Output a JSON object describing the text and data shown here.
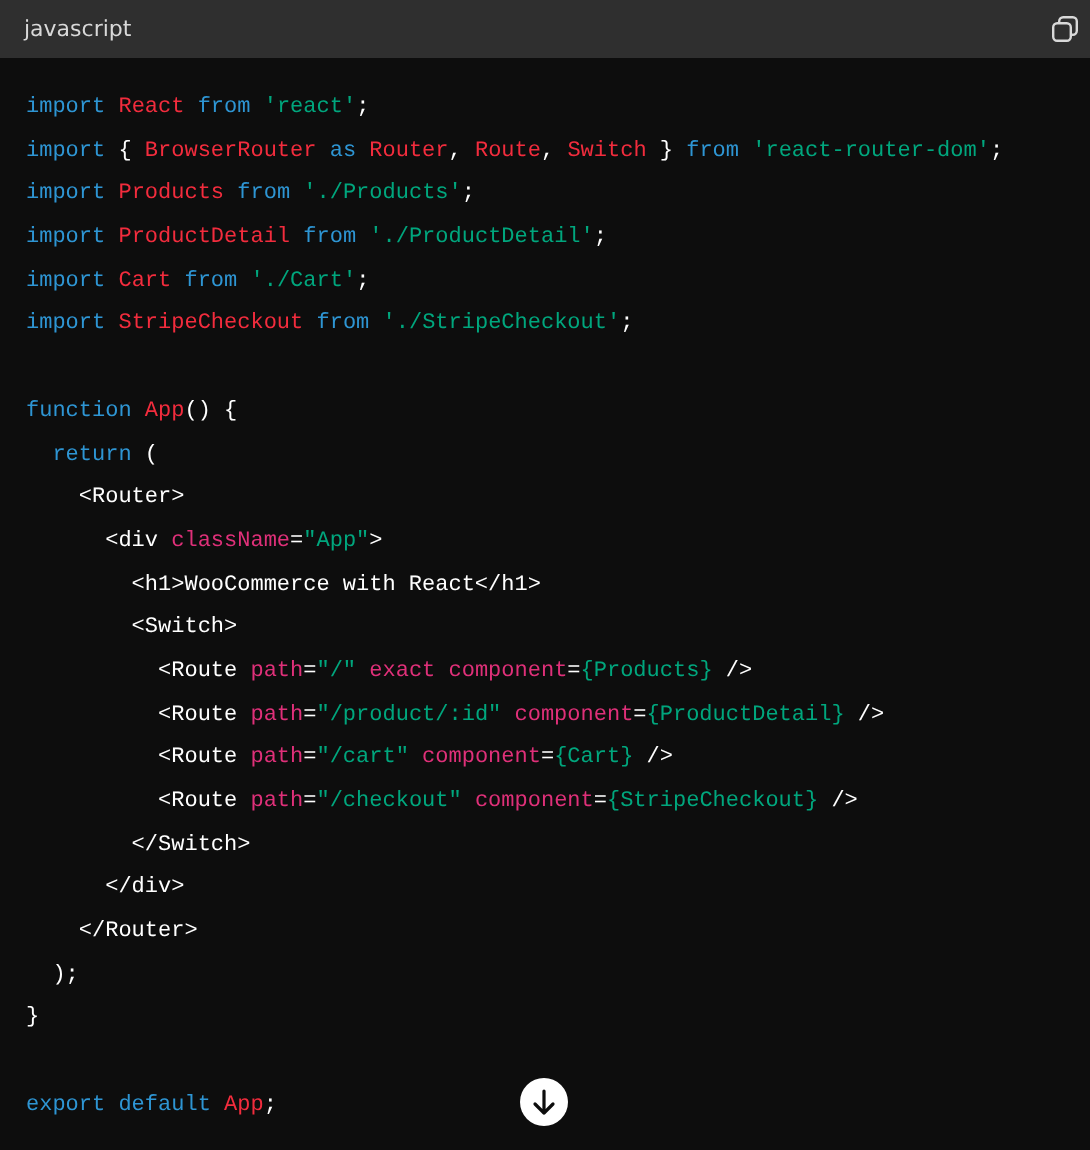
{
  "header": {
    "language": "javascript"
  },
  "lines": [
    {
      "kind": "code",
      "tokens": [
        {
          "kind": "kw",
          "text": "import "
        },
        {
          "kind": "name",
          "text": "React "
        },
        {
          "kind": "kw",
          "text": "from "
        },
        {
          "kind": "str",
          "text": "'react'"
        },
        {
          "kind": "plain",
          "text": ";"
        }
      ]
    },
    {
      "kind": "code",
      "tokens": [
        {
          "kind": "kw",
          "text": "import "
        },
        {
          "kind": "plain",
          "text": "{ "
        },
        {
          "kind": "name",
          "text": "BrowserRouter "
        },
        {
          "kind": "kw",
          "text": "as "
        },
        {
          "kind": "name",
          "text": "Router"
        },
        {
          "kind": "plain",
          "text": ", "
        },
        {
          "kind": "name",
          "text": "Route"
        },
        {
          "kind": "plain",
          "text": ", "
        },
        {
          "kind": "name",
          "text": "Switch"
        },
        {
          "kind": "plain",
          "text": " } "
        },
        {
          "kind": "kw",
          "text": "from "
        },
        {
          "kind": "str",
          "text": "'react-router-dom'"
        },
        {
          "kind": "plain",
          "text": ";"
        }
      ]
    },
    {
      "kind": "code",
      "tokens": [
        {
          "kind": "kw",
          "text": "import "
        },
        {
          "kind": "name",
          "text": "Products "
        },
        {
          "kind": "kw",
          "text": "from "
        },
        {
          "kind": "str",
          "text": "'./Products'"
        },
        {
          "kind": "plain",
          "text": ";"
        }
      ]
    },
    {
      "kind": "code",
      "tokens": [
        {
          "kind": "kw",
          "text": "import "
        },
        {
          "kind": "name",
          "text": "ProductDetail "
        },
        {
          "kind": "kw",
          "text": "from "
        },
        {
          "kind": "str",
          "text": "'./ProductDetail'"
        },
        {
          "kind": "plain",
          "text": ";"
        }
      ]
    },
    {
      "kind": "code",
      "tokens": [
        {
          "kind": "kw",
          "text": "import "
        },
        {
          "kind": "name",
          "text": "Cart "
        },
        {
          "kind": "kw",
          "text": "from "
        },
        {
          "kind": "str",
          "text": "'./Cart'"
        },
        {
          "kind": "plain",
          "text": ";"
        }
      ]
    },
    {
      "kind": "code",
      "tokens": [
        {
          "kind": "kw",
          "text": "import "
        },
        {
          "kind": "name",
          "text": "StripeCheckout "
        },
        {
          "kind": "kw",
          "text": "from "
        },
        {
          "kind": "str",
          "text": "'./StripeCheckout'"
        },
        {
          "kind": "plain",
          "text": ";"
        }
      ]
    },
    {
      "kind": "blank"
    },
    {
      "kind": "code",
      "tokens": [
        {
          "kind": "kw",
          "text": "function "
        },
        {
          "kind": "name",
          "text": "App"
        },
        {
          "kind": "plain",
          "text": "() {"
        }
      ]
    },
    {
      "kind": "code",
      "tokens": [
        {
          "kind": "kw",
          "text": "  return"
        },
        {
          "kind": "plain",
          "text": " ("
        }
      ]
    },
    {
      "kind": "code",
      "tokens": [
        {
          "kind": "plain",
          "text": "    <Router>"
        }
      ]
    },
    {
      "kind": "code",
      "tokens": [
        {
          "kind": "plain",
          "text": "      <div "
        },
        {
          "kind": "attr",
          "text": "className"
        },
        {
          "kind": "plain",
          "text": "="
        },
        {
          "kind": "str",
          "text": "\"App\""
        },
        {
          "kind": "plain",
          "text": ">"
        }
      ]
    },
    {
      "kind": "code",
      "tokens": [
        {
          "kind": "plain",
          "text": "        <h1>WooCommerce with React</h1>"
        }
      ]
    },
    {
      "kind": "code",
      "tokens": [
        {
          "kind": "plain",
          "text": "        <Switch>"
        }
      ]
    },
    {
      "kind": "code",
      "tokens": [
        {
          "kind": "plain",
          "text": "          <Route "
        },
        {
          "kind": "attr",
          "text": "path"
        },
        {
          "kind": "plain",
          "text": "="
        },
        {
          "kind": "str",
          "text": "\"/\""
        },
        {
          "kind": "attr",
          "text": " exact component"
        },
        {
          "kind": "plain",
          "text": "="
        },
        {
          "kind": "str",
          "text": "{Products}"
        },
        {
          "kind": "plain",
          "text": " />"
        }
      ]
    },
    {
      "kind": "code",
      "tokens": [
        {
          "kind": "plain",
          "text": "          <Route "
        },
        {
          "kind": "attr",
          "text": "path"
        },
        {
          "kind": "plain",
          "text": "="
        },
        {
          "kind": "str",
          "text": "\"/product/:id\""
        },
        {
          "kind": "attr",
          "text": " component"
        },
        {
          "kind": "plain",
          "text": "="
        },
        {
          "kind": "str",
          "text": "{ProductDetail}"
        },
        {
          "kind": "plain",
          "text": " />"
        }
      ]
    },
    {
      "kind": "code",
      "tokens": [
        {
          "kind": "plain",
          "text": "          <Route "
        },
        {
          "kind": "attr",
          "text": "path"
        },
        {
          "kind": "plain",
          "text": "="
        },
        {
          "kind": "str",
          "text": "\"/cart\""
        },
        {
          "kind": "attr",
          "text": " component"
        },
        {
          "kind": "plain",
          "text": "="
        },
        {
          "kind": "str",
          "text": "{Cart}"
        },
        {
          "kind": "plain",
          "text": " />"
        }
      ]
    },
    {
      "kind": "code",
      "tokens": [
        {
          "kind": "plain",
          "text": "          <Route "
        },
        {
          "kind": "attr",
          "text": "path"
        },
        {
          "kind": "plain",
          "text": "="
        },
        {
          "kind": "str",
          "text": "\"/checkout\""
        },
        {
          "kind": "attr",
          "text": " component"
        },
        {
          "kind": "plain",
          "text": "="
        },
        {
          "kind": "str",
          "text": "{StripeCheckout}"
        },
        {
          "kind": "plain",
          "text": " />"
        }
      ]
    },
    {
      "kind": "code",
      "tokens": [
        {
          "kind": "plain",
          "text": "        </Switch>"
        }
      ]
    },
    {
      "kind": "code",
      "tokens": [
        {
          "kind": "plain",
          "text": "      </div>"
        }
      ]
    },
    {
      "kind": "code",
      "tokens": [
        {
          "kind": "plain",
          "text": "    </Router>"
        }
      ]
    },
    {
      "kind": "code",
      "tokens": [
        {
          "kind": "plain",
          "text": "  );"
        }
      ]
    },
    {
      "kind": "code",
      "tokens": [
        {
          "kind": "plain",
          "text": "}"
        }
      ]
    },
    {
      "kind": "blank"
    },
    {
      "kind": "code",
      "tokens": [
        {
          "kind": "kw",
          "text": "export default "
        },
        {
          "kind": "name",
          "text": "App"
        },
        {
          "kind": "plain",
          "text": ";"
        }
      ]
    }
  ]
}
